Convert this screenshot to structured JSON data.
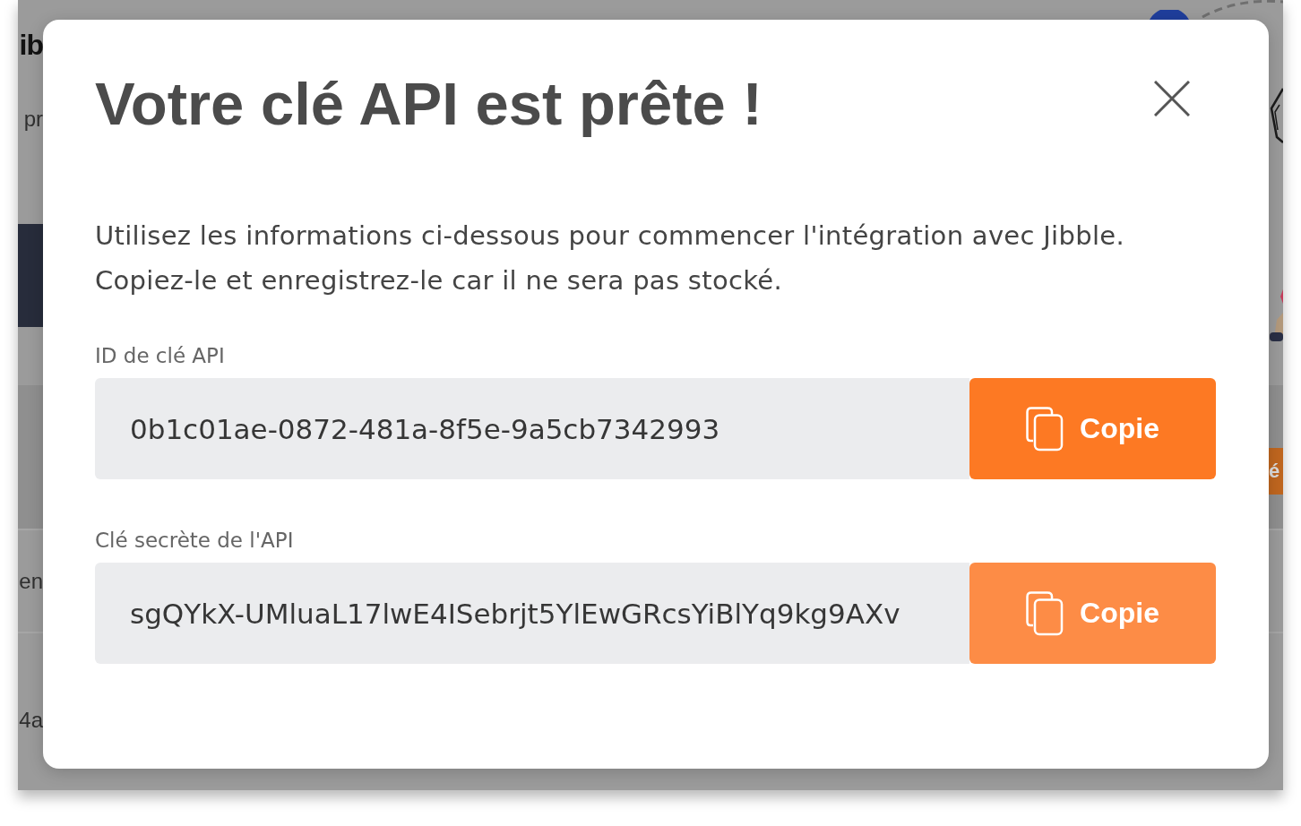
{
  "background": {
    "left_edge": [
      {
        "kind": "heading",
        "text": "ib"
      },
      {
        "kind": "text",
        "text": "pr"
      },
      {
        "kind": "text",
        "text": "en"
      },
      {
        "kind": "text",
        "text": "4a"
      }
    ],
    "right_edge": [
      {
        "kind": "button",
        "text": "é"
      }
    ]
  },
  "dialog": {
    "title": "Votre clé API est prête !",
    "description": "Utilisez les informations ci-dessous pour commencer l'intégration avec Jibble. Copiez-le et enregistrez-le car il ne sera pas stocké.",
    "fields": [
      {
        "label": "ID de clé API",
        "value": "0b1c01ae-0872-481a-8f5e-9a5cb7342993",
        "button": "Copie",
        "hovered": true
      },
      {
        "label": "Clé secrète de l'API",
        "value": "sgQYkX-UMluaL17lwE4ISebrjt5YlEwGRcsYiBlYq9kg9AXv",
        "button": "Copie",
        "hovered": false
      }
    ]
  }
}
